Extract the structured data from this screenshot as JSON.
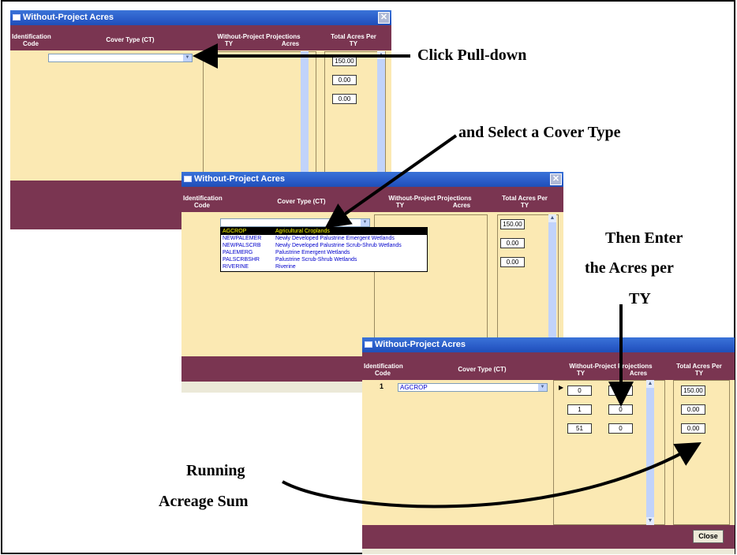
{
  "window_title": "Without-Project Acres",
  "columns": {
    "id_code": "Identification Code",
    "cover_type": "Cover Type (CT)",
    "projections": "Without-Project Projections",
    "ty": "TY",
    "acres": "Acres",
    "total": "Total Acres Per TY"
  },
  "window1": {
    "cover_value": "",
    "totals": [
      "150.00",
      "0.00",
      "0.00"
    ]
  },
  "window2": {
    "cover_value": "",
    "totals": [
      "150.00",
      "0.00",
      "0.00"
    ],
    "dropdown": [
      {
        "code": "AGCROP",
        "desc": "Agricultural Croplands",
        "selected": true
      },
      {
        "code": "NEWPALEMER",
        "desc": "Newly Developed Palustrine Emergent Wetlands"
      },
      {
        "code": "NEWPALSCRB",
        "desc": "Newly Developed Palustrine Scrub-Shrub Wetlands"
      },
      {
        "code": "PALEMERG",
        "desc": "Palustrine Emergent Wetlands"
      },
      {
        "code": "PALSCRBSHR",
        "desc": "Palustrine Scrub-Shrub Wetlands"
      },
      {
        "code": "RIVERINE",
        "desc": "Riverine"
      }
    ]
  },
  "window3": {
    "row_id": "1",
    "cover_value": "AGCROP",
    "projections": [
      {
        "ty": "0",
        "acres": "0"
      },
      {
        "ty": "1",
        "acres": "0"
      },
      {
        "ty": "51",
        "acres": "0"
      }
    ],
    "totals": [
      "150.00",
      "0.00",
      "0.00"
    ],
    "close_label": "Close"
  },
  "callouts": {
    "pulldown": "Click Pull-down",
    "select": "and Select a Cover Type",
    "enter_line1": "Then Enter",
    "enter_line2": "the Acres per",
    "enter_line3": "TY",
    "running_line1": "Running",
    "running_line2": "Acreage Sum"
  }
}
